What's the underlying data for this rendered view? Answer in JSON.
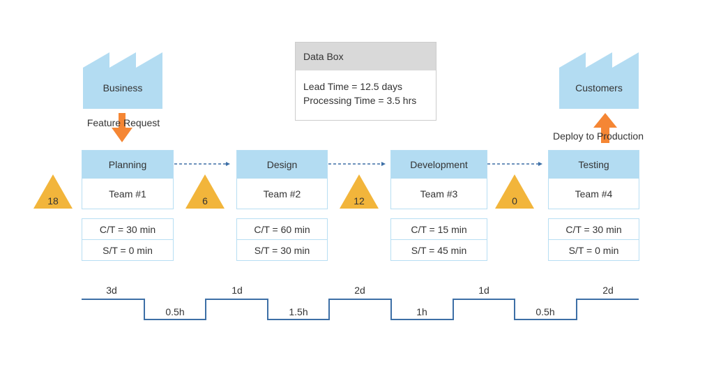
{
  "supplier": {
    "label": "Business",
    "flow_label": "Feature Request"
  },
  "customer": {
    "label": "Customers",
    "flow_label": "Deploy to Production"
  },
  "data_box": {
    "title": "Data Box",
    "lines": [
      "Lead Time = 12.5 days",
      "Processing Time = 3.5 hrs"
    ]
  },
  "processes": [
    {
      "name": "Planning",
      "team": "Team #1",
      "ct": "C/T = 30 min",
      "st": "S/T = 0 min"
    },
    {
      "name": "Design",
      "team": "Team #2",
      "ct": "C/T = 60 min",
      "st": "S/T = 30 min"
    },
    {
      "name": "Development",
      "team": "Team #3",
      "ct": "C/T = 15 min",
      "st": "S/T = 45 min"
    },
    {
      "name": "Testing",
      "team": "Team #4",
      "ct": "C/T = 30 min",
      "st": "S/T = 0 min"
    }
  ],
  "inventory": [
    "18",
    "6",
    "12",
    "0"
  ],
  "timeline": {
    "wait": [
      "3d",
      "1d",
      "2d",
      "1d",
      "2d"
    ],
    "process": [
      "0.5h",
      "1.5h",
      "1h",
      "0.5h"
    ]
  },
  "colors": {
    "process_header": "#b3dcf2",
    "factory": "#b3dcf2",
    "inventory": "#f2b53b",
    "arrow": "#f58634",
    "flow": "#3d6fa6"
  }
}
